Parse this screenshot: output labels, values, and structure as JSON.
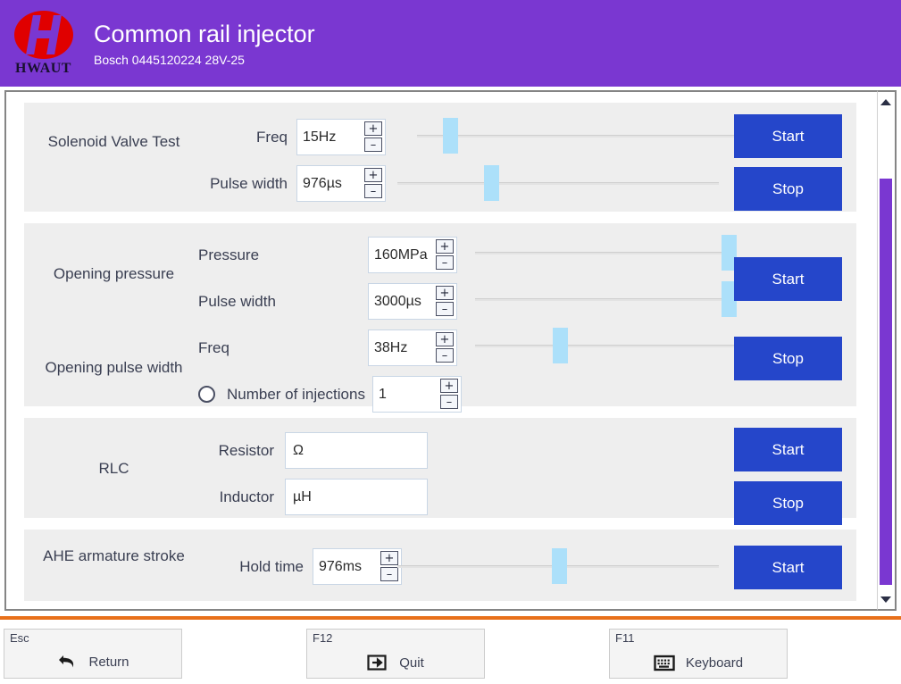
{
  "header": {
    "logo_text": "HWAUT",
    "title": "Common rail injector",
    "subtitle": "Bosch  0445120224  28V-25"
  },
  "sections": [
    {
      "name": "solenoid-valve-test",
      "label": "Solenoid Valve Test",
      "rows": [
        {
          "label": "Freq",
          "value": "15Hz",
          "plus": "+",
          "minus": "–",
          "slider_pct": 8
        },
        {
          "label": "Pulse width",
          "value": "976µs",
          "plus": "+",
          "minus": "–",
          "slider_pct": 27
        }
      ],
      "start_label": "Start",
      "stop_label": "Stop"
    },
    {
      "name": "opening-pressure",
      "label": "Opening pressure",
      "label2": "Opening pulse width",
      "rows": [
        {
          "label": "Pressure",
          "value": "160MPa",
          "plus": "+",
          "minus": "–",
          "slider_pct": 95
        },
        {
          "label": "Pulse width",
          "value": "3000µs",
          "plus": "+",
          "minus": "–",
          "slider_pct": 95
        },
        {
          "label": "Freq",
          "value": "38Hz",
          "plus": "+",
          "minus": "–",
          "slider_pct": 30
        },
        {
          "label": "Number of injections",
          "value": "1",
          "plus": "+",
          "minus": "–",
          "has_radio": true,
          "radio_checked": false
        }
      ],
      "start_label": "Start",
      "stop_label": "Stop"
    },
    {
      "name": "rlc",
      "label": "RLC",
      "rows": [
        {
          "label": "Resistor",
          "value": "Ω"
        },
        {
          "label": "Inductor",
          "value": "µH"
        }
      ],
      "start_label": "Start",
      "stop_label": "Stop"
    },
    {
      "name": "ahe-armature-stroke",
      "label": "AHE armature stroke",
      "rows": [
        {
          "label": "Hold time",
          "value": "976ms",
          "plus": "+",
          "minus": "–",
          "slider_pct": 48
        }
      ],
      "start_label": "Start"
    }
  ],
  "scrollbar": {
    "up_icon": "triangle-up-icon",
    "down_icon": "triangle-down-icon",
    "thumb_color": "#7a37d1"
  },
  "footer": {
    "keys": [
      {
        "tag": "Esc",
        "label": "Return",
        "icon": "return-arrow-icon"
      },
      {
        "tag": "F12",
        "label": "Quit",
        "icon": "exit-arrow-icon"
      },
      {
        "tag": "F11",
        "label": "Keyboard",
        "icon": "keyboard-icon"
      }
    ]
  },
  "colors": {
    "header_bg": "#7a37d1",
    "accent_orange": "#e8701a",
    "button_blue": "#2546ca",
    "slider_thumb": "#ace0fa",
    "section_bg": "#eeeeee"
  }
}
